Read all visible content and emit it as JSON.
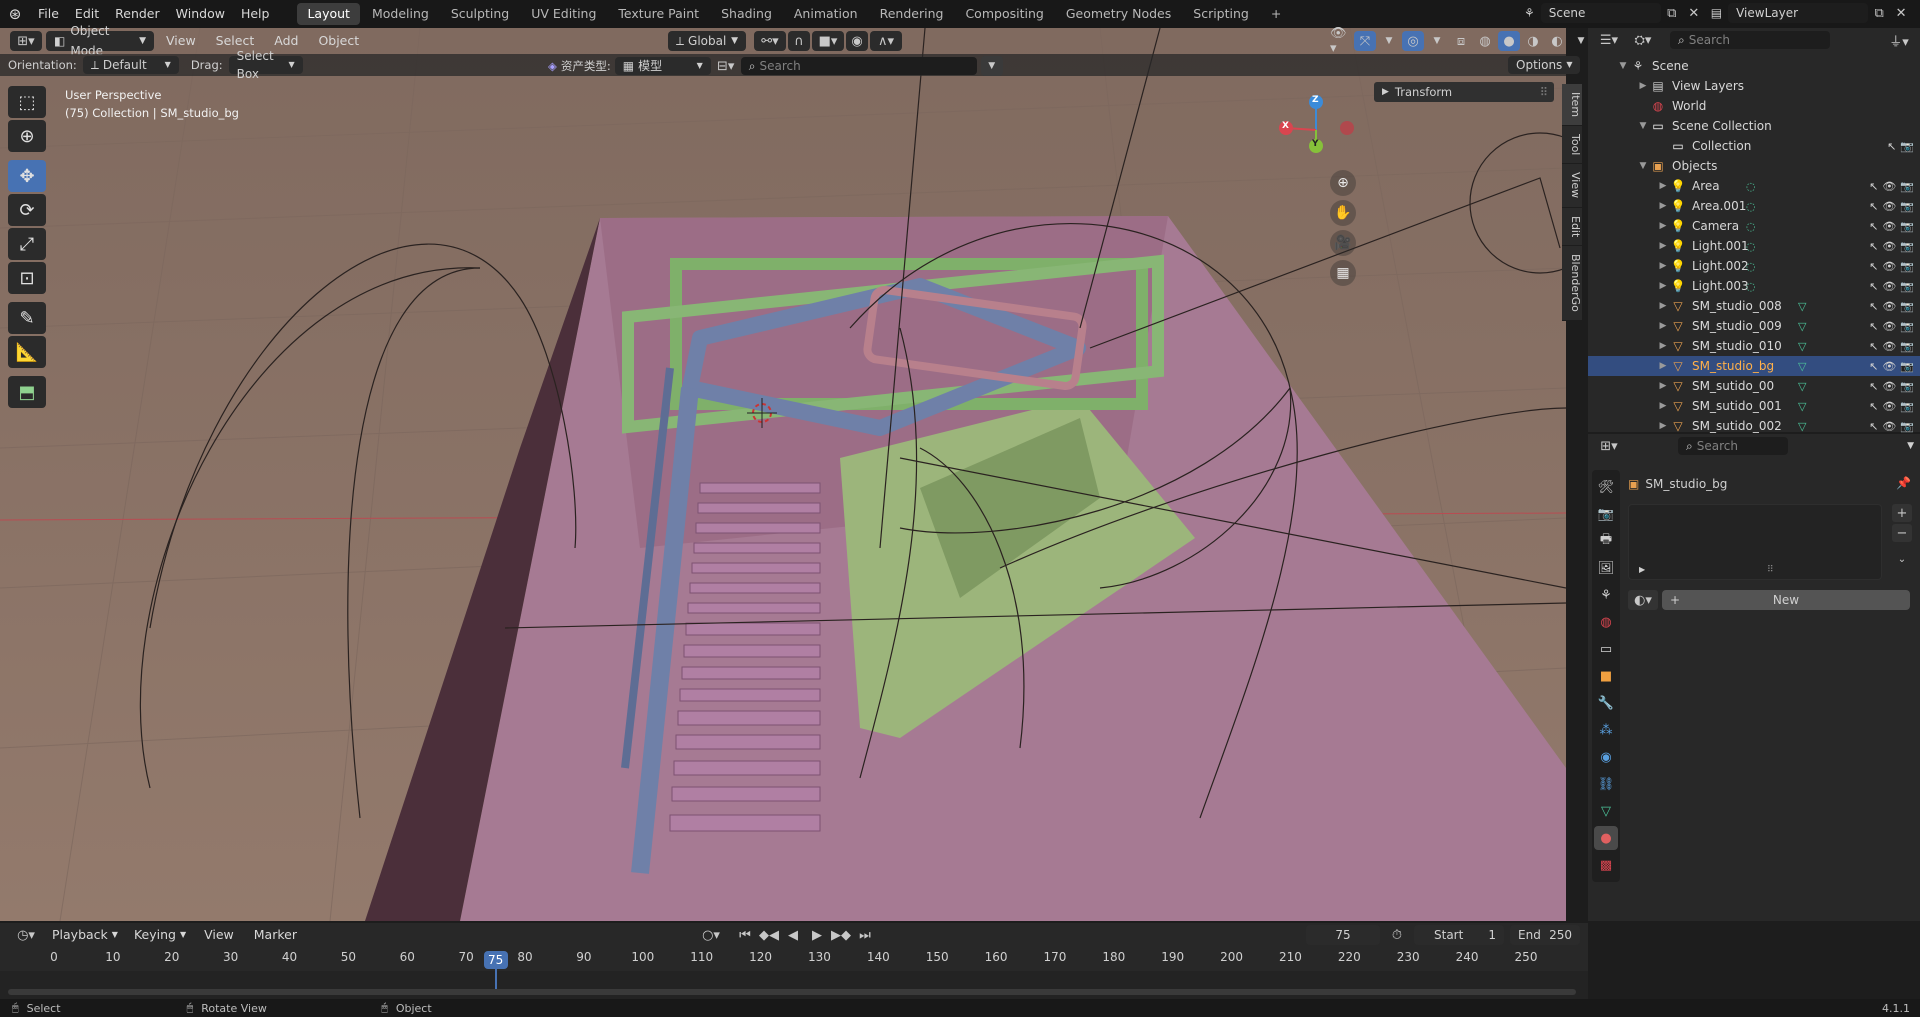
{
  "topbar": {
    "menus": [
      "File",
      "Edit",
      "Render",
      "Window",
      "Help"
    ],
    "workspaces": [
      "Layout",
      "Modeling",
      "Sculpting",
      "UV Editing",
      "Texture Paint",
      "Shading",
      "Animation",
      "Rendering",
      "Compositing",
      "Geometry Nodes",
      "Scripting"
    ],
    "active_workspace": "Layout",
    "add_workspace": "+",
    "scene": "Scene",
    "view_layer": "ViewLayer"
  },
  "viewport_header": {
    "mode": "Object Mode",
    "menus": [
      "View",
      "Select",
      "Add",
      "Object"
    ],
    "transform_orientation": "Global"
  },
  "tool_header": {
    "orientation_label": "Orientation:",
    "orientation_value": "Default",
    "drag_label": "Drag:",
    "drag_value": "Select Box",
    "asset_type_label": "资产类型:",
    "asset_type_value": "模型",
    "search_placeholder": "Search",
    "options_label": "Options"
  },
  "viewport": {
    "perspective": "User Perspective",
    "collection_info": "(75) Collection | SM_studio_bg",
    "transform_panel": "Transform",
    "gizmo": {
      "x": "X",
      "y": "Y",
      "z": "Z"
    },
    "side_tabs": [
      "Item",
      "Tool",
      "View",
      "Edit",
      "BlenderGo"
    ]
  },
  "outliner": {
    "search_placeholder": "Search",
    "rows": [
      {
        "label": "Scene",
        "indent": 0,
        "icon": "scene-icon",
        "arrow": "down"
      },
      {
        "label": "View Layers",
        "indent": 1,
        "icon": "view-layers-icon",
        "arrow": "right"
      },
      {
        "label": "World",
        "indent": 1,
        "icon": "world-icon",
        "arrow": ""
      },
      {
        "label": "Scene Collection",
        "indent": 1,
        "icon": "collection-icon",
        "arrow": "down"
      },
      {
        "label": "Collection",
        "indent": 2,
        "icon": "collection-icon",
        "arrow": ""
      },
      {
        "label": "Objects",
        "indent": 1,
        "icon": "folder-icon",
        "arrow": "down"
      },
      {
        "label": "Area",
        "indent": 2,
        "icon": "light-icon",
        "arrow": "right"
      },
      {
        "label": "Area.001",
        "indent": 2,
        "icon": "light-icon",
        "arrow": "right"
      },
      {
        "label": "Camera",
        "indent": 2,
        "icon": "light-icon",
        "arrow": "right"
      },
      {
        "label": "Light.001",
        "indent": 2,
        "icon": "light-icon",
        "arrow": "right"
      },
      {
        "label": "Light.002",
        "indent": 2,
        "icon": "light-icon",
        "arrow": "right"
      },
      {
        "label": "Light.003",
        "indent": 2,
        "icon": "light-icon",
        "arrow": "right"
      },
      {
        "label": "SM_studio_008",
        "indent": 2,
        "icon": "mesh-icon",
        "arrow": "right"
      },
      {
        "label": "SM_studio_009",
        "indent": 2,
        "icon": "mesh-icon",
        "arrow": "right"
      },
      {
        "label": "SM_studio_010",
        "indent": 2,
        "icon": "mesh-icon",
        "arrow": "right"
      },
      {
        "label": "SM_studio_bg",
        "indent": 2,
        "icon": "mesh-icon",
        "arrow": "right",
        "selected": true
      },
      {
        "label": "SM_sutido_00",
        "indent": 2,
        "icon": "mesh-icon",
        "arrow": "right"
      },
      {
        "label": "SM_sutido_001",
        "indent": 2,
        "icon": "mesh-icon",
        "arrow": "right"
      },
      {
        "label": "SM_sutido_002",
        "indent": 2,
        "icon": "mesh-icon",
        "arrow": "right"
      }
    ]
  },
  "properties": {
    "search_placeholder": "Search",
    "object_name": "SM_studio_bg",
    "new_button": "New"
  },
  "timeline": {
    "menus": [
      "Playback",
      "Keying",
      "View",
      "Marker"
    ],
    "current_frame": "75",
    "start_label": "Start",
    "start_value": "1",
    "end_label": "End",
    "end_value": "250",
    "ticks": [
      "0",
      "10",
      "20",
      "30",
      "40",
      "50",
      "60",
      "70",
      "75",
      "80",
      "90",
      "100",
      "110",
      "120",
      "130",
      "140",
      "150",
      "160",
      "170",
      "180",
      "190",
      "200",
      "210",
      "220",
      "230",
      "240",
      "250"
    ]
  },
  "statusbar": {
    "select": "Select",
    "rotate": "Rotate View",
    "object": "Object",
    "version": "4.1.1"
  }
}
